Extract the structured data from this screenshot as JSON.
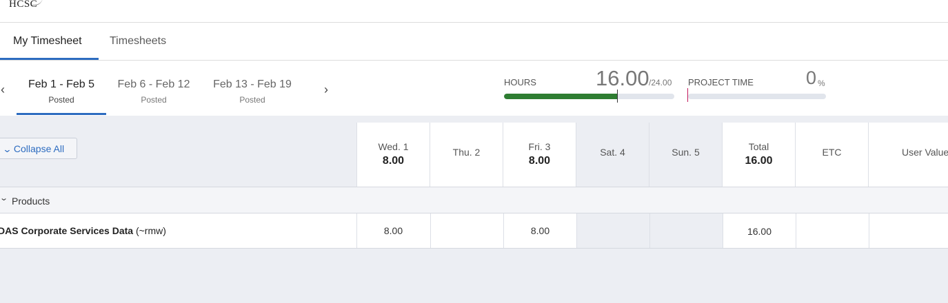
{
  "brand": {
    "logo_text": "HCSC"
  },
  "tabs": [
    {
      "label": "My Timesheet",
      "active": true
    },
    {
      "label": "Timesheets",
      "active": false
    }
  ],
  "periods": [
    {
      "range": "Feb 1 - Feb 5",
      "status": "Posted",
      "active": true
    },
    {
      "range": "Feb 6 - Feb 12",
      "status": "Posted",
      "active": false
    },
    {
      "range": "Feb 13 - Feb 19",
      "status": "Posted",
      "active": false
    }
  ],
  "nav": {
    "prev_icon": "chevron-left-icon",
    "next_icon": "chevron-right-icon"
  },
  "hours_meter": {
    "label": "HOURS",
    "value": "16.00",
    "max": "/24.00",
    "fill_fraction": 0.667,
    "color": "#2e7d32"
  },
  "project_time": {
    "label": "PROJECT TIME",
    "value": "0",
    "unit": "%",
    "fill_fraction": 0.0
  },
  "grid": {
    "collapse_label": "Collapse All",
    "columns": [
      {
        "label": "Wed. 1",
        "value": "8.00",
        "weekend": false
      },
      {
        "label": "Thu. 2",
        "value": "",
        "weekend": false
      },
      {
        "label": "Fri. 3",
        "value": "8.00",
        "weekend": false
      },
      {
        "label": "Sat. 4",
        "value": "",
        "weekend": true
      },
      {
        "label": "Sun. 5",
        "value": "",
        "weekend": true
      },
      {
        "label": "Total",
        "value": "16.00",
        "weekend": false
      },
      {
        "label": "ETC",
        "value": "",
        "weekend": false
      }
    ],
    "user_value_label": "User Value",
    "section": {
      "label": "Products",
      "expanded": true
    },
    "rows": [
      {
        "name": "DAS Corporate Services Data",
        "suffix": "(~rmw)",
        "cells": [
          "8.00",
          "",
          "8.00",
          "",
          "",
          "16.00",
          ""
        ]
      }
    ]
  },
  "colors": {
    "accent": "#2d6cc0",
    "progress": "#2e7d32",
    "marker": "#c2185b",
    "grid_bg": "#eceef3"
  }
}
